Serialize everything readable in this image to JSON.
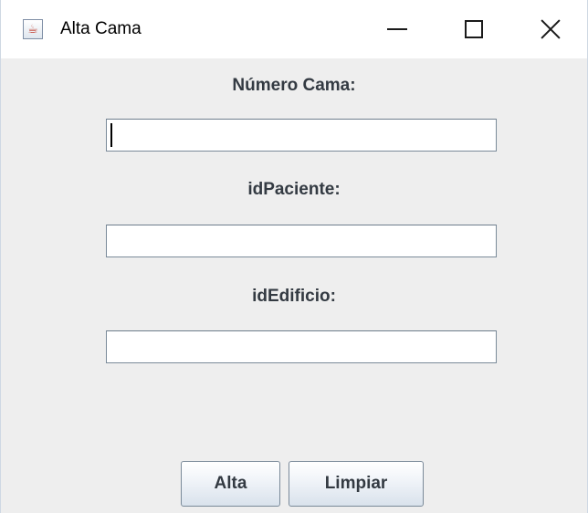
{
  "window": {
    "title": "Alta Cama",
    "app_icon": "java-cup-icon"
  },
  "form": {
    "fields": [
      {
        "label": "Número Cama:",
        "value": ""
      },
      {
        "label": "idPaciente:",
        "value": ""
      },
      {
        "label": "idEdificio:",
        "value": ""
      }
    ]
  },
  "buttons": {
    "alta_label": "Alta",
    "limpiar_label": "Limpiar"
  }
}
